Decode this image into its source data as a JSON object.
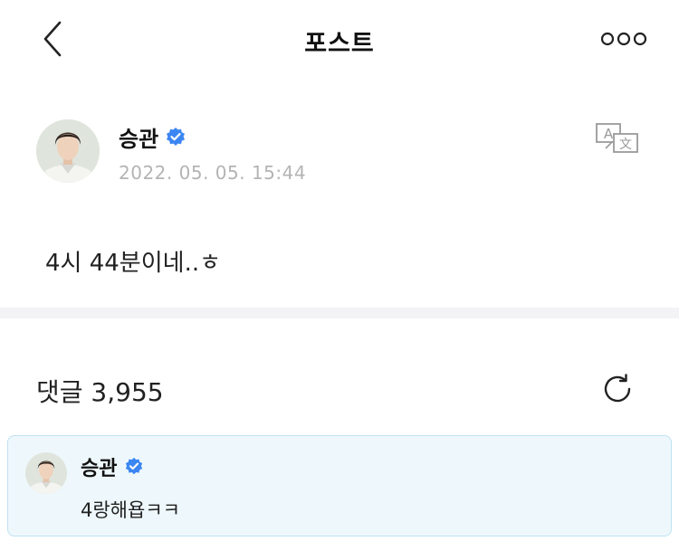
{
  "header": {
    "title": "포스트",
    "back_icon": "chevron-left-icon",
    "more_icon": "more-horizontal-icon"
  },
  "post": {
    "author": "승관",
    "verified_icon": "verified-badge-icon",
    "date": "2022. 05. 05. 15:44",
    "text": "4시 44분이네..ㅎ",
    "translate_icon": "translate-icon"
  },
  "comments": {
    "label": "댓글 3,955",
    "refresh_icon": "refresh-icon",
    "items": [
      {
        "author": "승관",
        "text": "4랑해욥ㅋㅋ"
      }
    ]
  },
  "colors": {
    "verified": "#3b86f2",
    "highlight_bg": "#eef8fc",
    "highlight_border": "#bfe2f1",
    "date": "#b4b4b4",
    "divider": "#f3f3f5"
  }
}
